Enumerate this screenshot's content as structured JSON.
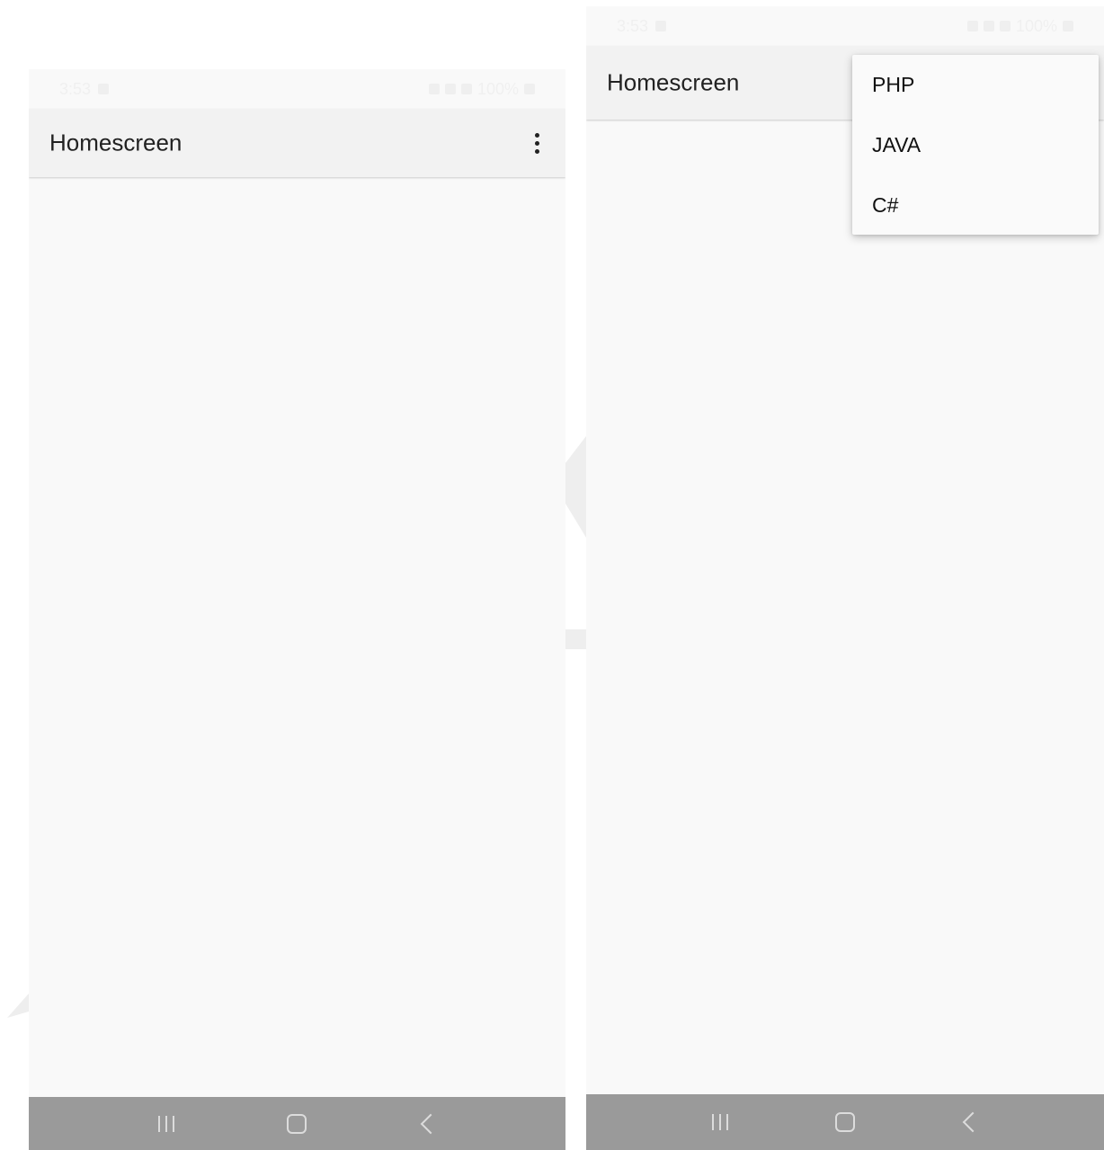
{
  "left_screen": {
    "status": {
      "time": "3:53",
      "battery": "100%"
    },
    "appbar": {
      "title": "Homescreen",
      "overflow_icon": "more-vert-icon"
    },
    "navbar": {
      "recents_icon": "recents-icon",
      "home_icon": "home-icon",
      "back_icon": "back-icon"
    }
  },
  "right_screen": {
    "status": {
      "time": "3:53",
      "battery": "100%"
    },
    "appbar": {
      "title": "Homescreen"
    },
    "menu": {
      "items": [
        {
          "label": "PHP"
        },
        {
          "label": "JAVA"
        },
        {
          "label": "C#"
        }
      ]
    },
    "navbar": {
      "recents_icon": "recents-icon",
      "home_icon": "home-icon",
      "back_icon": "back-icon"
    }
  },
  "colors": {
    "background": "#f9f9f9",
    "appbar": "#f2f2f2",
    "navbar": "#9a9a9a",
    "text": "#222222"
  }
}
